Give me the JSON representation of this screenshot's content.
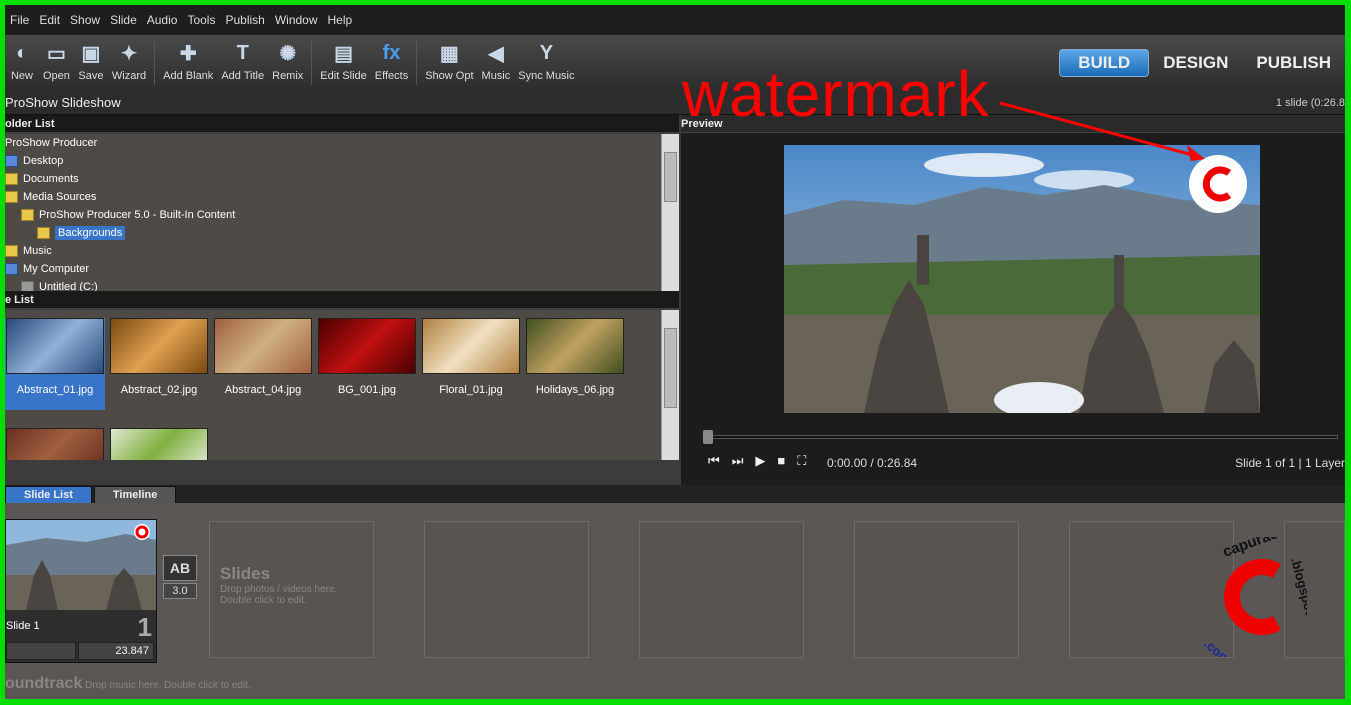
{
  "menu": [
    "File",
    "Edit",
    "Show",
    "Slide",
    "Audio",
    "Tools",
    "Publish",
    "Window",
    "Help"
  ],
  "toolbar": [
    {
      "label": "New",
      "icon": "new-show-icon"
    },
    {
      "label": "Open",
      "icon": "open-folder-icon"
    },
    {
      "label": "Save",
      "icon": "floppy-disk-icon"
    },
    {
      "label": "Wizard",
      "icon": "magic-wand-icon"
    },
    {
      "label": "Add Blank",
      "icon": "add-blank-slide-icon"
    },
    {
      "label": "Add Title",
      "icon": "add-title-slide-icon"
    },
    {
      "label": "Remix",
      "icon": "remix-icon"
    },
    {
      "label": "Edit Slide",
      "icon": "edit-slide-icon"
    },
    {
      "label": "Effects",
      "icon": "fx-icon"
    },
    {
      "label": "Show Opt",
      "icon": "show-options-icon"
    },
    {
      "label": "Music",
      "icon": "speaker-icon"
    },
    {
      "label": "Sync Music",
      "icon": "sync-music-icon"
    }
  ],
  "modes": [
    "BUILD",
    "DESIGN",
    "PUBLISH"
  ],
  "title": {
    "project": "ProShow Slideshow",
    "summary": "1 slide (0:26.8"
  },
  "folder_list": {
    "header": "older List",
    "items": [
      {
        "label": "ProShow Producer",
        "indent": 0,
        "icon": "none"
      },
      {
        "label": "Desktop",
        "indent": 0,
        "icon": "blue"
      },
      {
        "label": "Documents",
        "indent": 0,
        "icon": "folder"
      },
      {
        "label": "Media Sources",
        "indent": 0,
        "icon": "folder"
      },
      {
        "label": "ProShow Producer 5.0 - Built-In Content",
        "indent": 1,
        "icon": "folder"
      },
      {
        "label": "Backgrounds",
        "indent": 2,
        "icon": "folder",
        "selected": true
      },
      {
        "label": "Music",
        "indent": 0,
        "icon": "folder"
      },
      {
        "label": "My Computer",
        "indent": 0,
        "icon": "blue"
      },
      {
        "label": "Untitled (C:)",
        "indent": 1,
        "icon": "gray"
      }
    ]
  },
  "file_list": {
    "header": "e List",
    "items": [
      {
        "label": "Abstract_01.jpg",
        "selected": true,
        "c1": "#2a4a7a",
        "c2": "#8fb0d8"
      },
      {
        "label": "Abstract_02.jpg",
        "c1": "#7a4a10",
        "c2": "#e0a050"
      },
      {
        "label": "Abstract_04.jpg",
        "c1": "#a06040",
        "c2": "#d0b080"
      },
      {
        "label": "BG_001.jpg",
        "c1": "#4a0000",
        "c2": "#c01010"
      },
      {
        "label": "Floral_01.jpg",
        "c1": "#b08040",
        "c2": "#f0e0c0"
      },
      {
        "label": "Holidays_06.jpg",
        "c1": "#405020",
        "c2": "#c0a060"
      },
      {
        "label": "",
        "c1": "#6a3020",
        "c2": "#a06040"
      },
      {
        "label": "",
        "c1": "#e0e8d0",
        "c2": "#80b040"
      }
    ]
  },
  "preview": {
    "header": "Preview",
    "time": "0:00.00 / 0:26.84",
    "status": "Slide 1 of 1  |  1 Layer"
  },
  "tabs": [
    "Slide List",
    "Timeline"
  ],
  "slide": {
    "name": "Slide 1",
    "number": "1",
    "duration": "23.847",
    "transition_label": "AB",
    "transition_time": "3.0"
  },
  "slides_placeholder": {
    "title": "Slides",
    "line1": "Drop photos / videos here.",
    "line2": "Double click to edit."
  },
  "soundtrack": {
    "title": "oundtrack",
    "hint": "Drop music here.  Double click to edit."
  },
  "watermark": {
    "text": "watermark",
    "logo_text": "capuraca.blogspot.com"
  },
  "colors": {
    "accent": "#3874c8",
    "frame": "#00e000",
    "watermark": "#ff0000"
  }
}
